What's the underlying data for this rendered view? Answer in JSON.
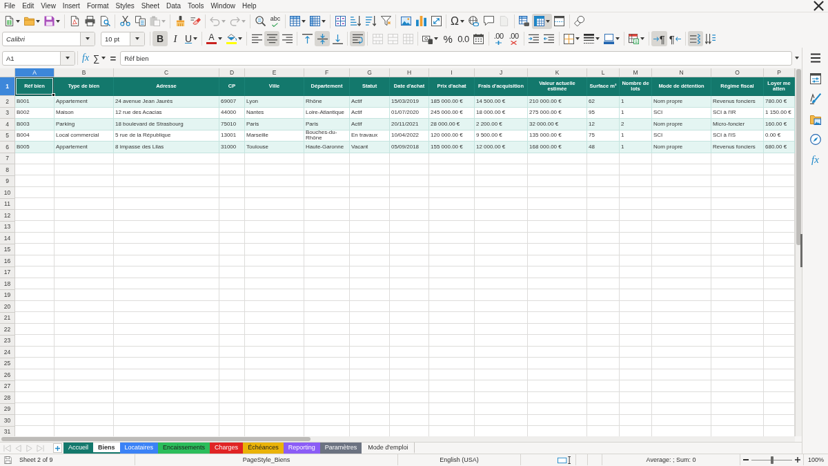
{
  "menu_bar": {
    "items": [
      "File",
      "Edit",
      "View",
      "Insert",
      "Format",
      "Styles",
      "Sheet",
      "Data",
      "Tools",
      "Window",
      "Help"
    ]
  },
  "standard_toolbar": {
    "buttons": [
      {
        "pressed": false,
        "disabled": false
      },
      {
        "pressed": false,
        "disabled": false
      },
      {
        "pressed": false,
        "disabled": false
      },
      {
        "pressed": false,
        "disabled": false
      },
      {
        "pressed": false,
        "disabled": false
      },
      {
        "pressed": false,
        "disabled": false
      },
      {
        "pressed": false,
        "disabled": false
      },
      {
        "pressed": false,
        "disabled": false
      },
      {
        "pressed": false,
        "disabled": true
      },
      {
        "pressed": false,
        "disabled": false
      },
      {
        "pressed": false,
        "disabled": false
      },
      {
        "pressed": false,
        "disabled": true
      },
      {
        "pressed": false,
        "disabled": true
      },
      {
        "pressed": false,
        "disabled": false
      },
      {
        "glyph": "abc",
        "pressed": false,
        "disabled": false
      },
      {
        "pressed": false,
        "disabled": false
      },
      {
        "pressed": false,
        "disabled": false
      },
      {
        "pressed": false,
        "disabled": false
      },
      {
        "pressed": false,
        "disabled": false
      },
      {
        "pressed": false,
        "disabled": false
      },
      {
        "pressed": false,
        "disabled": false
      },
      {
        "pressed": false,
        "disabled": false
      },
      {
        "pressed": false,
        "disabled": false
      },
      {
        "pressed": false,
        "disabled": false
      },
      {
        "glyph": "Ω",
        "pressed": false,
        "disabled": false
      },
      {
        "pressed": false,
        "disabled": false
      },
      {
        "pressed": false,
        "disabled": false
      },
      {
        "pressed": false,
        "disabled": true
      },
      {
        "pressed": false,
        "disabled": false
      },
      {
        "pressed": true,
        "disabled": false
      },
      {
        "pressed": false,
        "disabled": false
      },
      {
        "pressed": false,
        "disabled": false
      }
    ]
  },
  "formatting_toolbar": {
    "font_name": "Calibri",
    "font_size": "10 pt",
    "buttons": [
      {
        "glyph": "B",
        "pressed": true,
        "disabled": false
      },
      {
        "glyph": "I",
        "pressed": false,
        "disabled": false
      },
      {
        "glyph": "U",
        "pressed": false,
        "disabled": false
      },
      {
        "glyph": "A",
        "color": "#c9211e",
        "pressed": false,
        "disabled": false
      },
      {
        "color": "#ffff00",
        "pressed": false,
        "disabled": false
      },
      {
        "pressed": false,
        "disabled": false
      },
      {
        "pressed": true,
        "disabled": false
      },
      {
        "pressed": false,
        "disabled": false
      },
      {
        "pressed": false,
        "disabled": false
      },
      {
        "pressed": true,
        "disabled": false
      },
      {
        "pressed": false,
        "disabled": false
      },
      {
        "pressed": true,
        "disabled": false
      },
      {
        "pressed": false,
        "disabled": true
      },
      {
        "pressed": false,
        "disabled": true
      },
      {
        "pressed": false,
        "disabled": true
      },
      {
        "pressed": false,
        "disabled": false
      },
      {
        "glyph": "%",
        "pressed": false,
        "disabled": false
      },
      {
        "glyph": "0.0",
        "pressed": false,
        "disabled": false
      },
      {
        "pressed": false,
        "disabled": false
      },
      {
        "glyph": ".00",
        "pressed": false,
        "disabled": false
      },
      {
        "glyph": ".00",
        "pressed": false,
        "disabled": false
      },
      {
        "pressed": false,
        "disabled": false
      },
      {
        "pressed": false,
        "disabled": false
      },
      {
        "pressed": false,
        "disabled": false
      },
      {
        "pressed": false,
        "disabled": false
      },
      {
        "pressed": false,
        "disabled": false
      },
      {
        "pressed": false,
        "disabled": false
      },
      {
        "glyph": "¶",
        "pressed": true,
        "disabled": false
      },
      {
        "glyph": "¶",
        "pressed": false,
        "disabled": false
      },
      {
        "pressed": true,
        "disabled": false
      },
      {
        "pressed": false,
        "disabled": false
      }
    ]
  },
  "formula_bar": {
    "name_box": "A1",
    "function_wizard": "fx",
    "sum": "∑",
    "formula_symbol": "=",
    "content": "Réf bien"
  },
  "sheet": {
    "columns": [
      {
        "label": "A",
        "selected": true
      },
      {
        "label": "B",
        "selected": false
      },
      {
        "label": "C",
        "selected": false
      },
      {
        "label": "D",
        "selected": false
      },
      {
        "label": "E",
        "selected": false
      },
      {
        "label": "F",
        "selected": false
      },
      {
        "label": "G",
        "selected": false
      },
      {
        "label": "H",
        "selected": false
      },
      {
        "label": "I",
        "selected": false
      },
      {
        "label": "J",
        "selected": false
      },
      {
        "label": "K",
        "selected": false
      },
      {
        "label": "L",
        "selected": false
      },
      {
        "label": "M",
        "selected": false
      },
      {
        "label": "N",
        "selected": false
      },
      {
        "label": "O",
        "selected": false
      },
      {
        "label": "P",
        "selected": false
      }
    ],
    "rows": [
      {
        "label": "1",
        "selected": true
      },
      {
        "label": "2",
        "selected": false
      },
      {
        "label": "3",
        "selected": false
      },
      {
        "label": "4",
        "selected": false
      },
      {
        "label": "5",
        "selected": false
      },
      {
        "label": "6",
        "selected": false
      },
      {
        "label": "7",
        "selected": false
      },
      {
        "label": "8",
        "selected": false
      },
      {
        "label": "9",
        "selected": false
      },
      {
        "label": "10",
        "selected": false
      },
      {
        "label": "11",
        "selected": false
      },
      {
        "label": "12",
        "selected": false
      },
      {
        "label": "13",
        "selected": false
      },
      {
        "label": "14",
        "selected": false
      },
      {
        "label": "15",
        "selected": false
      },
      {
        "label": "16",
        "selected": false
      },
      {
        "label": "17",
        "selected": false
      },
      {
        "label": "18",
        "selected": false
      },
      {
        "label": "19",
        "selected": false
      },
      {
        "label": "20",
        "selected": false
      },
      {
        "label": "21",
        "selected": false
      },
      {
        "label": "22",
        "selected": false
      },
      {
        "label": "23",
        "selected": false
      },
      {
        "label": "24",
        "selected": false
      },
      {
        "label": "25",
        "selected": false
      },
      {
        "label": "26",
        "selected": false
      },
      {
        "label": "27",
        "selected": false
      },
      {
        "label": "28",
        "selected": false
      },
      {
        "label": "29",
        "selected": false
      },
      {
        "label": "30",
        "selected": false
      },
      {
        "label": "31",
        "selected": false
      }
    ],
    "header_row": [
      "Réf bien",
      "Type de bien",
      "Adresse",
      "CP",
      "Ville",
      "Département",
      "Statut",
      "Date d'achat",
      "Prix d'achat",
      "Frais d'acquisition",
      "Valeur actuelle estimée",
      "Surface m²",
      "Nombre de lots",
      "Mode de détention",
      "Régime fiscal",
      "Loyer me atten"
    ],
    "data_rows": [
      [
        "B001",
        "Appartement",
        "24 avenue Jean Jaurès",
        "69007",
        "Lyon",
        "Rhône",
        "Actif",
        "15/03/2019",
        "185 000.00 €",
        "14 500.00 €",
        "210 000.00 €",
        "62",
        "1",
        "Nom propre",
        "Revenus fonciers",
        "780.00 €"
      ],
      [
        "B002",
        "Maison",
        "12 rue des Acacias",
        "44000",
        "Nantes",
        "Loire-Atlantique",
        "Actif",
        "01/07/2020",
        "245 000.00 €",
        "18 000.00 €",
        "275 000.00 €",
        "95",
        "1",
        "SCI",
        "SCI à l'IR",
        "1 150.00 €"
      ],
      [
        "B003",
        "Parking",
        "18 boulevard de Strasbourg",
        "75010",
        "Paris",
        "Paris",
        "Actif",
        "20/11/2021",
        "28 000.00 €",
        "2 200.00 €",
        "32 000.00 €",
        "12",
        "2",
        "Nom propre",
        "Micro-foncier",
        "160.00 €"
      ],
      [
        "B004",
        "Local commercial",
        "5 rue de la République",
        "13001",
        "Marseille",
        "Bouches-du-Rhône",
        "En travaux",
        "10/04/2022",
        "120 000.00 €",
        "9 500.00 €",
        "135 000.00 €",
        "75",
        "1",
        "SCI",
        "SCI à l'IS",
        "0.00 €"
      ],
      [
        "B005",
        "Appartement",
        "8 impasse des Lilas",
        "31000",
        "Toulouse",
        "Haute-Garonne",
        "Vacant",
        "05/09/2018",
        "155 000.00 €",
        "12 000.00 €",
        "168 000.00 €",
        "48",
        "1",
        "Nom propre",
        "Revenus fonciers",
        "680.00 €"
      ]
    ]
  },
  "tab_navigation": {
    "buttons": [
      {
        "disabled": true
      },
      {
        "disabled": true
      },
      {
        "disabled": true
      },
      {
        "disabled": true
      }
    ]
  },
  "sheet_tabs": [
    {
      "label": "Accueil",
      "color": "#13786c",
      "selected": false
    },
    {
      "label": "Biens",
      "color": "#13786c",
      "selected": true
    },
    {
      "label": "Locataires",
      "color": "#3b82f6",
      "selected": false
    },
    {
      "label": "Encaissements",
      "color": "#2bbd5b",
      "selected": false
    },
    {
      "label": "Charges",
      "color": "#e02424",
      "selected": false
    },
    {
      "label": "Échéances",
      "color": "#eab308",
      "selected": false
    },
    {
      "label": "Reporting",
      "color": "#8b5cf6",
      "selected": false
    },
    {
      "label": "Paramètres",
      "color": "#6b7280",
      "selected": false
    },
    {
      "label": "Mode d'emploi",
      "selected": false
    }
  ],
  "sidebar": {
    "buttons": [
      {
        "selected": false
      },
      {
        "selected": false
      },
      {
        "selected": false
      },
      {
        "selected": false
      },
      {
        "glyph": "fx",
        "selected": false
      }
    ]
  },
  "status_bar": {
    "sheet_position": "Sheet 2 of 9",
    "page_style": "PageStyle_Biens",
    "language": "English (USA)",
    "selection_summary": "Average: ; Sum: 0",
    "zoom": {
      "level": 0.5,
      "reading": "100%"
    }
  }
}
